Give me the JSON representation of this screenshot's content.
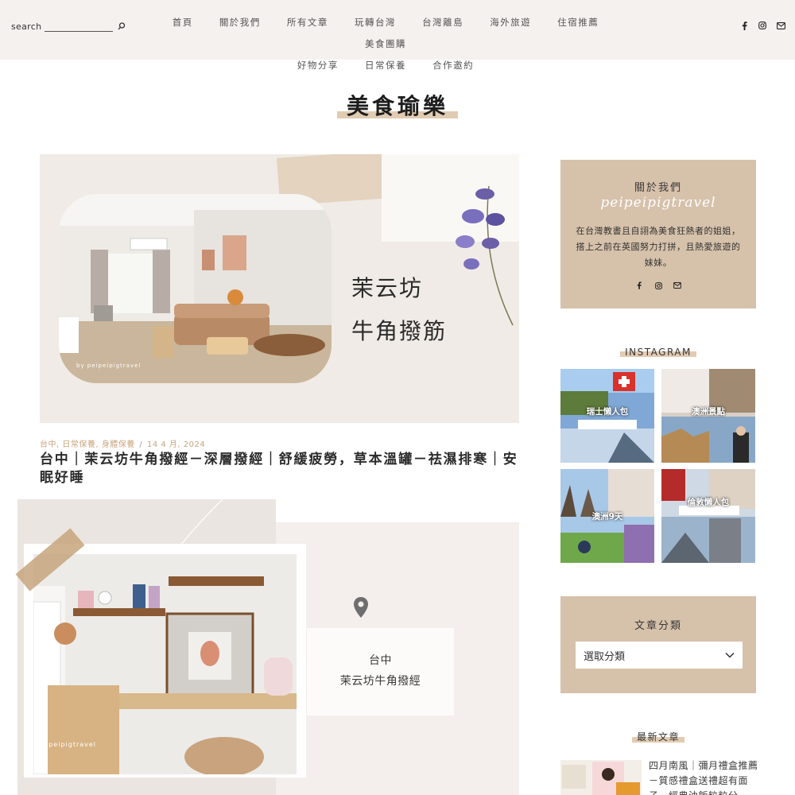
{
  "header": {
    "search_label": "search",
    "search_placeholder": "",
    "nav": [
      "首頁",
      "關於我們",
      "所有文章",
      "玩轉台灣",
      "台灣離島",
      "海外旅遊",
      "住宿推薦",
      "美食團購",
      "好物分享",
      "日常保養",
      "合作邀約"
    ],
    "social_icons": [
      "facebook-icon",
      "instagram-icon",
      "email-icon"
    ]
  },
  "page": {
    "title": "美食瑜樂"
  },
  "post1": {
    "cover_script_line1": "茉云坊",
    "cover_script_line2": "牛角撥筋",
    "cover_watermark": "by peipeipigtravel",
    "meta_categories": "台中, 日常保養, 身體保養",
    "meta_separator": "/",
    "meta_date": "14 4 月, 2024",
    "title": "台中｜茉云坊牛角撥經－深層撥經｜舒緩疲勞，草本溫罐－祛濕排寒｜安眠好睡"
  },
  "post2": {
    "location_line1": "台中",
    "location_line2": "茉云坊牛角撥經",
    "watermark": "peipeipigtravel"
  },
  "sidebar": {
    "about": {
      "heading": "關於我們",
      "script": "peipeipigtravel",
      "text": "在台灣教書且自詡為美食狂熱者的姐姐，搭上之前在英國努力打拼，且熱愛旅遊的妹妹。"
    },
    "instagram_heading": "INSTAGRAM",
    "instagram_tiles": [
      {
        "caption": "瑞士懶人包"
      },
      {
        "caption": "澳洲景點"
      },
      {
        "caption": "澳洲9天"
      },
      {
        "caption": "倫敦懶人包"
      }
    ],
    "categories": {
      "heading": "文章分類",
      "selected": "選取分類"
    },
    "recent": {
      "heading": "最新文章",
      "first_title": "四月南風｜彌月禮盒推薦－質感禮盒送禮超有面子，經典油飯粒粒分"
    }
  },
  "colors": {
    "accent": "#d6c1aa",
    "highlight": "#e2cbb3",
    "topbar": "#f5f1ef",
    "meta": "#c9a47d"
  }
}
